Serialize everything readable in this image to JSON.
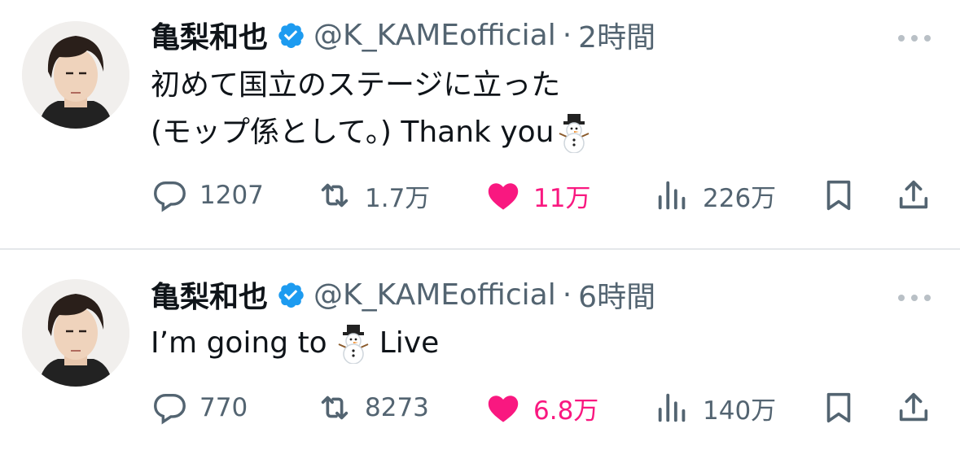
{
  "colors": {
    "text": "#0f1419",
    "secondary": "#536471",
    "like": "#f91880",
    "verified": "#1d9bf0",
    "divider": "#e4e7ea"
  },
  "tweets": [
    {
      "display_name": "亀梨和也",
      "handle": "@K_KAMEofficial",
      "separator": "·",
      "time": "2時間",
      "text_lines": [
        "初めて国立のステージに立った",
        "(モップ係として。) Thank you"
      ],
      "emoji": "snowman",
      "counts": {
        "replies": "1207",
        "reposts": "1.7万",
        "likes": "11万",
        "views": "226万"
      },
      "liked": true
    },
    {
      "display_name": "亀梨和也",
      "handle": "@K_KAMEofficial",
      "separator": "·",
      "time": "6時間",
      "text_before": "I’m going to",
      "text_after": "Live",
      "emoji": "snowman",
      "counts": {
        "replies": "770",
        "reposts": "8273",
        "likes": "6.8万",
        "views": "140万"
      },
      "liked": true
    }
  ]
}
